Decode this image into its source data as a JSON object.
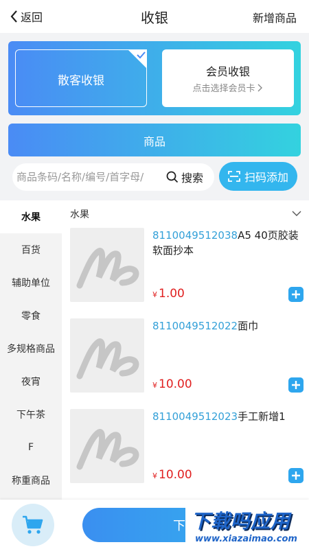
{
  "header": {
    "back_label": "返回",
    "title": "收银",
    "add_goods_label": "新增商品"
  },
  "modes": {
    "walkin_label": "散客收银",
    "member_label": "会员收银",
    "member_sub": "点击选择会员卡"
  },
  "goods_bar_label": "商品",
  "search": {
    "placeholder": "商品条码/名称/编号/首字母/",
    "button_label": "搜索",
    "scan_label": "扫码添加"
  },
  "categories": [
    "水果",
    "百货",
    "辅助单位",
    "零食",
    "多规格商品",
    "夜宵",
    "下午茶",
    "F",
    "称重商品"
  ],
  "list": {
    "header": "水果",
    "products": [
      {
        "code": "8110049512038",
        "name": "A5 40页胶装软面抄本",
        "currency": "¥",
        "price": "1.00"
      },
      {
        "code": "8110049512022",
        "name": "面巾",
        "currency": "¥",
        "price": "10.00"
      },
      {
        "code": "8110049512023",
        "name": "手工新增1",
        "currency": "¥",
        "price": "10.00"
      }
    ]
  },
  "bottom": {
    "order_label": "下",
    "watermark_main": "下载吗应用",
    "watermark_sub": "www.xiazaimao.com"
  },
  "colors": {
    "accent": "#33b6ee",
    "gradient_start": "#4a8bf5",
    "gradient_end": "#33d2df",
    "price": "#e02020",
    "code": "#33a0d8"
  }
}
